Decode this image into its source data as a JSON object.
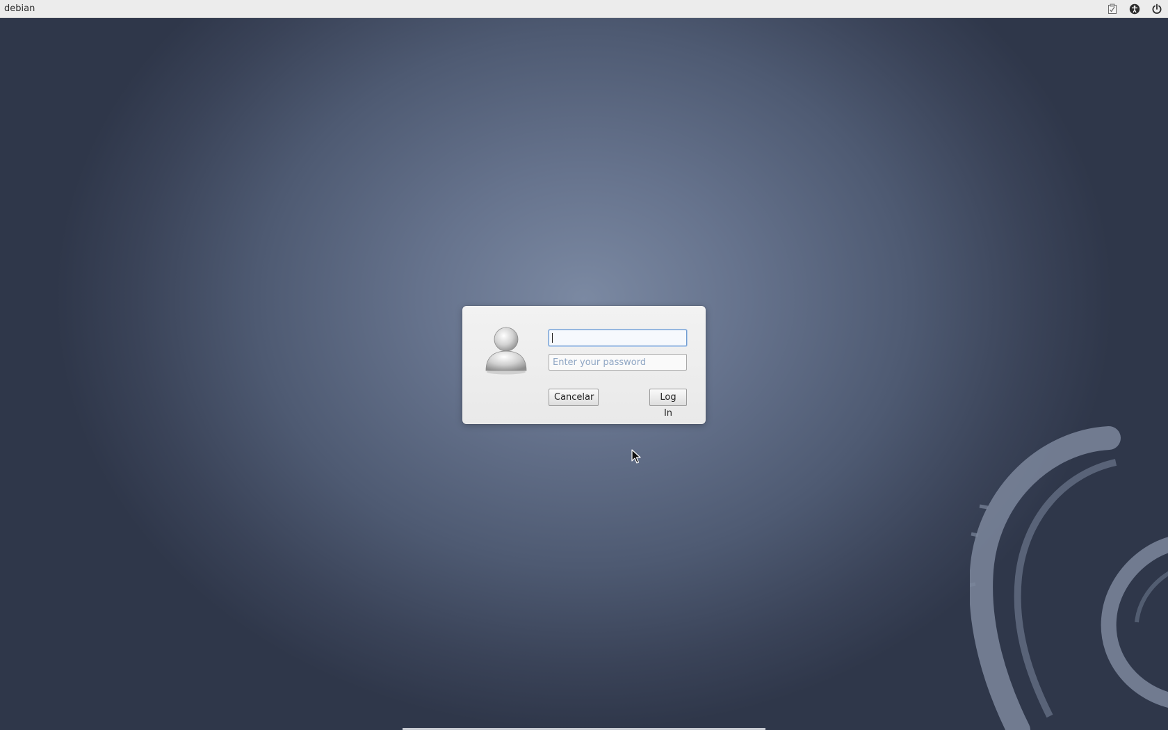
{
  "topbar": {
    "hostname": "debian",
    "tray_icons": [
      "keyboard-layout-icon",
      "accessibility-icon",
      "power-icon"
    ]
  },
  "login": {
    "username_value": "",
    "password_placeholder": "Enter your password",
    "cancel_label": "Cancelar",
    "login_label": "Log In"
  },
  "colors": {
    "background_center": "#7b89a2",
    "background_edge": "#2f374a",
    "focus_ring": "#6f9bd0"
  }
}
